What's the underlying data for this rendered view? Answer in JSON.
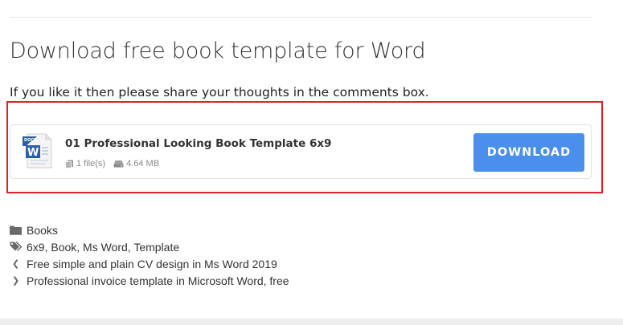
{
  "page": {
    "title": "Download free book template for Word",
    "intro": "If you like it then please share your thoughts in the comments box."
  },
  "download_card": {
    "file_icon_badge": "DOCX",
    "file_icon_letter": "W",
    "file_name": "01 Professional Looking Book Template 6x9",
    "file_count": "1 file(s)",
    "file_size": "4.64 MB",
    "button_label": "DOWNLOAD",
    "button_color": "#4a8fea"
  },
  "post_meta": {
    "category_icon": "folder-icon",
    "category": "Books",
    "tags_icon": "tags-icon",
    "tags": "6x9, Book, Ms Word, Template",
    "prev_post": "Free simple and plain CV design in Ms Word 2019",
    "next_post": "Professional invoice template in Microsoft Word, free"
  },
  "colors": {
    "highlight_border": "#e02222",
    "word_blue": "#2b5faa"
  }
}
